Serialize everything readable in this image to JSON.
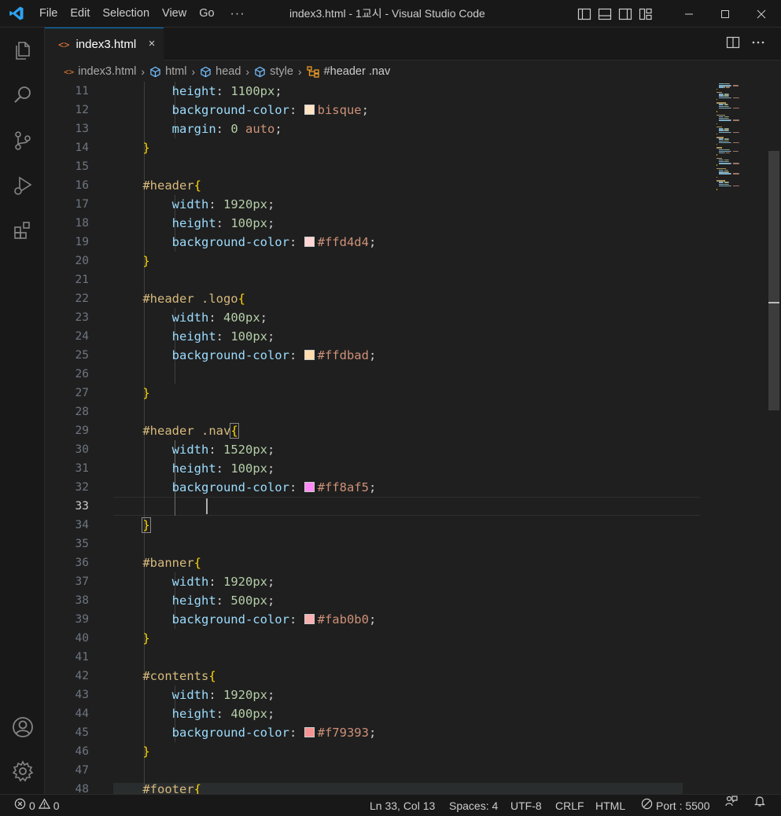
{
  "titlebar": {
    "menu": [
      "File",
      "Edit",
      "Selection",
      "View",
      "Go",
      "···"
    ],
    "title": "index3.html - 1교시 - Visual Studio Code",
    "accent": "#0078d4"
  },
  "activity": [
    "explorer-icon",
    "search-icon",
    "source-control-icon",
    "run-debug-icon",
    "extensions-icon",
    "account-icon",
    "manage-gear-icon"
  ],
  "tab": {
    "label": "index3.html",
    "close": "×"
  },
  "breadcrumb": [
    "index3.html",
    "html",
    "head",
    "style",
    "#header .nav"
  ],
  "editor": {
    "active_line": 33,
    "line_numbers": [
      "11",
      "12",
      "13",
      "14",
      "15",
      "16",
      "17",
      "18",
      "19",
      "20",
      "21",
      "22",
      "23",
      "24",
      "25",
      "26",
      "27",
      "28",
      "29",
      "30",
      "31",
      "32",
      "33",
      "34",
      "35",
      "36",
      "37",
      "38",
      "39",
      "40",
      "41",
      "42",
      "43",
      "44",
      "45",
      "46",
      "47",
      "48"
    ],
    "lines": [
      [
        {
          "t": "        "
        },
        {
          "t": "height",
          "c": "prop"
        },
        {
          "t": ": ",
          "c": "punc"
        },
        {
          "t": "1100px",
          "c": "num"
        },
        {
          "t": ";",
          "c": "punc"
        }
      ],
      [
        {
          "t": "        "
        },
        {
          "t": "background-color",
          "c": "prop"
        },
        {
          "t": ": ",
          "c": "punc"
        },
        {
          "sw": "#ffe4c4"
        },
        {
          "t": "bisque",
          "c": "kw"
        },
        {
          "t": ";",
          "c": "punc"
        }
      ],
      [
        {
          "t": "        "
        },
        {
          "t": "margin",
          "c": "prop"
        },
        {
          "t": ": ",
          "c": "punc"
        },
        {
          "t": "0",
          "c": "num"
        },
        {
          "t": " "
        },
        {
          "t": "auto",
          "c": "kw"
        },
        {
          "t": ";",
          "c": "punc"
        }
      ],
      [
        {
          "t": "    "
        },
        {
          "t": "}",
          "c": "brace"
        }
      ],
      [],
      [
        {
          "t": "    "
        },
        {
          "t": "#header",
          "c": "sel"
        },
        {
          "t": "{",
          "c": "brace"
        }
      ],
      [
        {
          "t": "        "
        },
        {
          "t": "width",
          "c": "prop"
        },
        {
          "t": ": ",
          "c": "punc"
        },
        {
          "t": "1920px",
          "c": "num"
        },
        {
          "t": ";",
          "c": "punc"
        }
      ],
      [
        {
          "t": "        "
        },
        {
          "t": "height",
          "c": "prop"
        },
        {
          "t": ": ",
          "c": "punc"
        },
        {
          "t": "100px",
          "c": "num"
        },
        {
          "t": ";",
          "c": "punc"
        }
      ],
      [
        {
          "t": "        "
        },
        {
          "t": "background-color",
          "c": "prop"
        },
        {
          "t": ": ",
          "c": "punc"
        },
        {
          "sw": "#ffd4d4"
        },
        {
          "t": "#ffd4d4",
          "c": "kw"
        },
        {
          "t": ";",
          "c": "punc"
        }
      ],
      [
        {
          "t": "    "
        },
        {
          "t": "}",
          "c": "brace"
        }
      ],
      [],
      [
        {
          "t": "    "
        },
        {
          "t": "#header .logo",
          "c": "sel"
        },
        {
          "t": "{",
          "c": "brace"
        }
      ],
      [
        {
          "t": "        "
        },
        {
          "t": "width",
          "c": "prop"
        },
        {
          "t": ": ",
          "c": "punc"
        },
        {
          "t": "400px",
          "c": "num"
        },
        {
          "t": ";",
          "c": "punc"
        }
      ],
      [
        {
          "t": "        "
        },
        {
          "t": "height",
          "c": "prop"
        },
        {
          "t": ": ",
          "c": "punc"
        },
        {
          "t": "100px",
          "c": "num"
        },
        {
          "t": ";",
          "c": "punc"
        }
      ],
      [
        {
          "t": "        "
        },
        {
          "t": "background-color",
          "c": "prop"
        },
        {
          "t": ": ",
          "c": "punc"
        },
        {
          "sw": "#ffdbad"
        },
        {
          "t": "#ffdbad",
          "c": "kw"
        },
        {
          "t": ";",
          "c": "punc"
        }
      ],
      [],
      [
        {
          "t": "    "
        },
        {
          "t": "}",
          "c": "brace"
        }
      ],
      [],
      [
        {
          "t": "    "
        },
        {
          "t": "#header .nav",
          "c": "sel"
        },
        {
          "t": "{",
          "c": "brace",
          "box": true
        }
      ],
      [
        {
          "t": "        "
        },
        {
          "t": "width",
          "c": "prop"
        },
        {
          "t": ": ",
          "c": "punc"
        },
        {
          "t": "1520px",
          "c": "num"
        },
        {
          "t": ";",
          "c": "punc"
        }
      ],
      [
        {
          "t": "        "
        },
        {
          "t": "height",
          "c": "prop"
        },
        {
          "t": ": ",
          "c": "punc"
        },
        {
          "t": "100px",
          "c": "num"
        },
        {
          "t": ";",
          "c": "punc"
        }
      ],
      [
        {
          "t": "        "
        },
        {
          "t": "background-color",
          "c": "prop"
        },
        {
          "t": ": ",
          "c": "punc"
        },
        {
          "sw": "#ff8af5"
        },
        {
          "t": "#ff8af5",
          "c": "kw"
        },
        {
          "t": ";",
          "c": "punc"
        }
      ],
      [],
      [
        {
          "t": "    "
        },
        {
          "t": "}",
          "c": "brace",
          "box": true
        }
      ],
      [],
      [
        {
          "t": "    "
        },
        {
          "t": "#banner",
          "c": "sel"
        },
        {
          "t": "{",
          "c": "brace"
        }
      ],
      [
        {
          "t": "        "
        },
        {
          "t": "width",
          "c": "prop"
        },
        {
          "t": ": ",
          "c": "punc"
        },
        {
          "t": "1920px",
          "c": "num"
        },
        {
          "t": ";",
          "c": "punc"
        }
      ],
      [
        {
          "t": "        "
        },
        {
          "t": "height",
          "c": "prop"
        },
        {
          "t": ": ",
          "c": "punc"
        },
        {
          "t": "500px",
          "c": "num"
        },
        {
          "t": ";",
          "c": "punc"
        }
      ],
      [
        {
          "t": "        "
        },
        {
          "t": "background-color",
          "c": "prop"
        },
        {
          "t": ": ",
          "c": "punc"
        },
        {
          "sw": "#fab0b0"
        },
        {
          "t": "#fab0b0",
          "c": "kw"
        },
        {
          "t": ";",
          "c": "punc"
        }
      ],
      [
        {
          "t": "    "
        },
        {
          "t": "}",
          "c": "brace"
        }
      ],
      [],
      [
        {
          "t": "    "
        },
        {
          "t": "#contents",
          "c": "sel"
        },
        {
          "t": "{",
          "c": "brace"
        }
      ],
      [
        {
          "t": "        "
        },
        {
          "t": "width",
          "c": "prop"
        },
        {
          "t": ": ",
          "c": "punc"
        },
        {
          "t": "1920px",
          "c": "num"
        },
        {
          "t": ";",
          "c": "punc"
        }
      ],
      [
        {
          "t": "        "
        },
        {
          "t": "height",
          "c": "prop"
        },
        {
          "t": ": ",
          "c": "punc"
        },
        {
          "t": "400px",
          "c": "num"
        },
        {
          "t": ";",
          "c": "punc"
        }
      ],
      [
        {
          "t": "        "
        },
        {
          "t": "background-color",
          "c": "prop"
        },
        {
          "t": ": ",
          "c": "punc"
        },
        {
          "sw": "#f79393"
        },
        {
          "t": "#f79393",
          "c": "kw"
        },
        {
          "t": ";",
          "c": "punc"
        }
      ],
      [
        {
          "t": "    "
        },
        {
          "t": "}",
          "c": "brace"
        }
      ],
      [],
      [
        {
          "t": "    "
        },
        {
          "t": "#footer",
          "c": "sel"
        },
        {
          "t": "{",
          "c": "brace"
        }
      ]
    ]
  },
  "status": {
    "errors": "0",
    "warnings": "0",
    "position": "Ln 33, Col 13",
    "spaces": "Spaces: 4",
    "encoding": "UTF-8",
    "eol": "CRLF",
    "language": "HTML",
    "port": "Port : 5500"
  }
}
